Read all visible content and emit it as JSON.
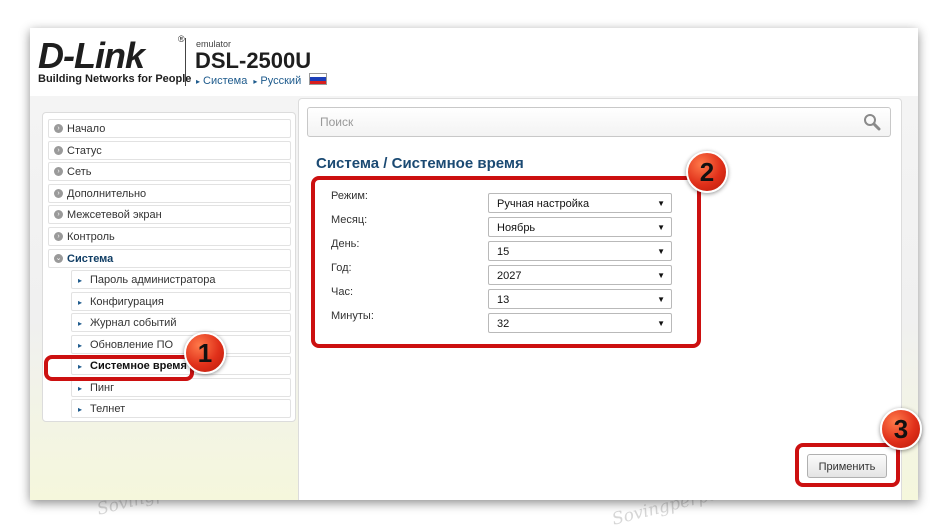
{
  "header": {
    "logo_text": "D-Link",
    "logo_reg": "®",
    "logo_tagline": "Building Networks for People",
    "emulator_label": "emulator",
    "model": "DSL-2500U",
    "breadcrumb": [
      "Система",
      "Русский"
    ],
    "flag_colors": [
      "#ffffff",
      "#1c3fb8",
      "#d81e1e"
    ]
  },
  "sidebar": {
    "items": [
      {
        "label": "Начало"
      },
      {
        "label": "Статус"
      },
      {
        "label": "Сеть"
      },
      {
        "label": "Дополнительно"
      },
      {
        "label": "Межсетевой экран"
      },
      {
        "label": "Контроль"
      },
      {
        "label": "Система",
        "expanded": true
      }
    ],
    "subitems": [
      {
        "label": "Пароль администратора"
      },
      {
        "label": "Конфигурация"
      },
      {
        "label": "Журнал событий"
      },
      {
        "label": "Обновление ПО"
      },
      {
        "label": "Системное время",
        "active": true
      },
      {
        "label": "Пинг"
      },
      {
        "label": "Телнет"
      }
    ],
    "trailing_items": [
      {
        "label": "Телнет"
      }
    ]
  },
  "search": {
    "placeholder": "Поиск",
    "icon": "search-icon"
  },
  "main": {
    "breadcrumb_title": "Система / Системное время",
    "fields": [
      {
        "label": "Режим:",
        "value": "Ручная настройка"
      },
      {
        "label": "Месяц:",
        "value": "Ноябрь"
      },
      {
        "label": "День:",
        "value": "15"
      },
      {
        "label": "Год:",
        "value": "2027"
      },
      {
        "label": "Час:",
        "value": "13"
      },
      {
        "label": "Минуты:",
        "value": "32"
      }
    ],
    "apply_label": "Применить"
  },
  "annotations": {
    "marker_1": "1",
    "marker_2": "2",
    "marker_3": "3",
    "highlight_color": "#cc1010"
  },
  "watermark": "Sovingperpair.Com"
}
